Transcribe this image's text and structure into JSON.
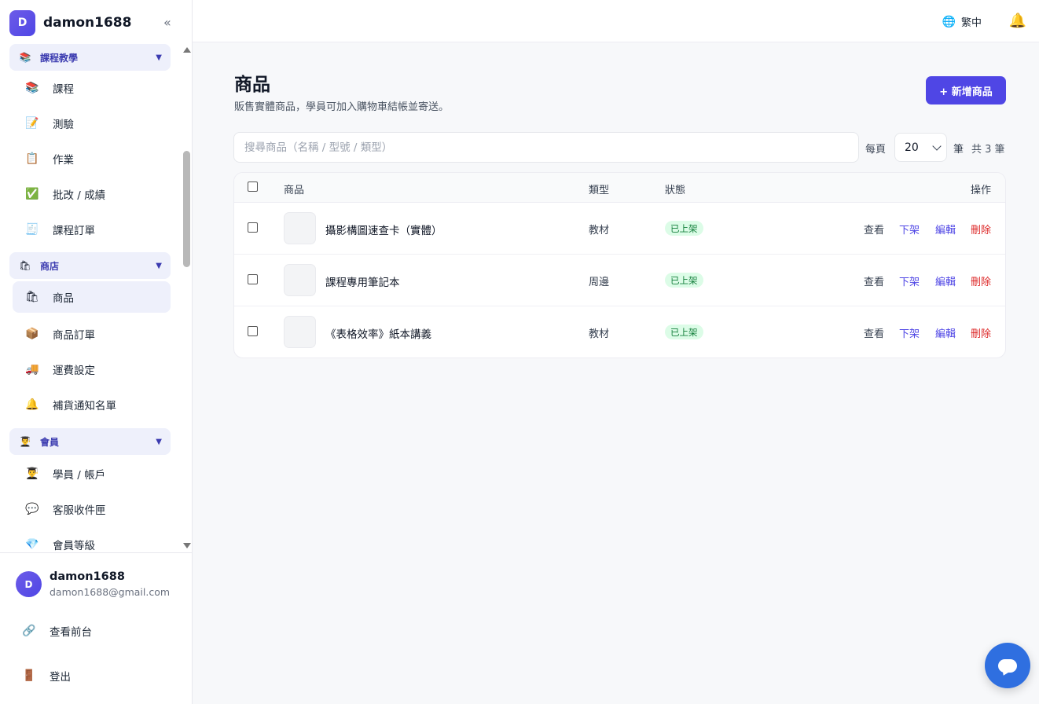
{
  "brand": {
    "initial": "D",
    "name": "damon1688",
    "collapse_icon": "«"
  },
  "sidebar": {
    "groups": [
      {
        "label": "課程教學",
        "icon": "books-icon",
        "glyph": "📚",
        "caret": "▼"
      },
      {
        "label": "商店",
        "icon": "shopping-bag-icon",
        "glyph": "🛍",
        "caret": "▼"
      },
      {
        "label": "會員",
        "icon": "student-icon",
        "glyph": "👨‍🎓",
        "caret": "▼"
      }
    ],
    "items": [
      {
        "label": "課程",
        "icon": "books-icon",
        "glyph": "📚"
      },
      {
        "label": "測驗",
        "icon": "memo-icon",
        "glyph": "📝"
      },
      {
        "label": "作業",
        "icon": "clipboard-icon",
        "glyph": "📋"
      },
      {
        "label": "批改 / 成績",
        "icon": "check-mark-icon",
        "glyph": "✅"
      },
      {
        "label": "課程訂單",
        "icon": "receipt-icon",
        "glyph": "🧾"
      },
      {
        "label": "商品",
        "icon": "shopping-bags-icon",
        "glyph": "🛍"
      },
      {
        "label": "商品訂單",
        "icon": "package-icon",
        "glyph": "📦"
      },
      {
        "label": "運費設定",
        "icon": "truck-icon",
        "glyph": "🚚"
      },
      {
        "label": "補貨通知名單",
        "icon": "bell-icon",
        "glyph": "🔔"
      },
      {
        "label": "學員 / 帳戶",
        "icon": "student-icon",
        "glyph": "👨‍🎓"
      },
      {
        "label": "客服收件匣",
        "icon": "speech-bubble-icon",
        "glyph": "💬"
      },
      {
        "label": "會員等級",
        "icon": "gem-icon",
        "glyph": "💎"
      }
    ]
  },
  "user": {
    "initial": "D",
    "name": "damon1688",
    "email": "damon1688@gmail.com",
    "links": [
      {
        "label": "查看前台",
        "icon": "link-icon",
        "glyph": "🔗"
      },
      {
        "label": "登出",
        "icon": "door-icon",
        "glyph": "🚪"
      }
    ]
  },
  "topbar": {
    "language": "繁中",
    "globe_glyph": "🌐",
    "bell_glyph": "🔔"
  },
  "main": {
    "title": "商品",
    "subtitle": "販售實體商品，學員可加入購物車結帳並寄送。",
    "add_button": "+ 新增商品",
    "search_placeholder": "搜尋商品（名稱 / 型號 / 類型）",
    "per_page_label": "每頁",
    "per_page_value": "20",
    "per_page_unit": "筆",
    "total_text": "共 3 筆"
  },
  "table": {
    "headers": {
      "product": "商品",
      "type": "類型",
      "status": "狀態",
      "actions": "操作"
    },
    "rows": [
      {
        "name": "攝影構圖速查卡（實體）",
        "type": "教材",
        "status": "已上架"
      },
      {
        "name": "課程專用筆記本",
        "type": "周邊",
        "status": "已上架"
      },
      {
        "name": "《表格效率》紙本講義",
        "type": "教材",
        "status": "已上架"
      }
    ],
    "actions": {
      "view": "查看",
      "unpublish": "下架",
      "edit": "編輯",
      "delete": "刪除"
    }
  },
  "colors": {
    "accent": "#4f46e5",
    "status_green": "#15803d",
    "danger": "#dc2626",
    "chat": "#2f6fe0"
  }
}
